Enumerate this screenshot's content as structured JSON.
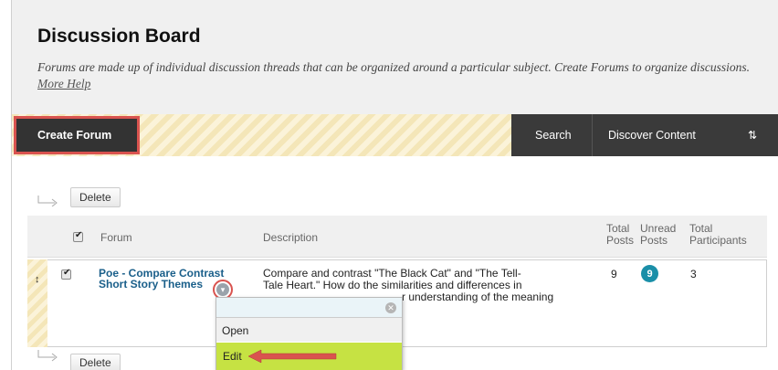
{
  "header": {
    "title": "Discussion Board",
    "subtitle": "Forums are made up of individual discussion threads that can be organized around a particular subject. Create Forums to organize discussions.",
    "help_link": "More Help"
  },
  "actionbar": {
    "create_forum": "Create Forum",
    "search": "Search",
    "discover": "Discover Content",
    "sort_icon": "⇅"
  },
  "list": {
    "delete_label": "Delete",
    "columns": {
      "forum": "Forum",
      "description": "Description",
      "total_posts_1": "Total",
      "total_posts_2": "Posts",
      "unread_posts_1": "Unread",
      "unread_posts_2": "Posts",
      "participants_1": "Total",
      "participants_2": "Participants"
    },
    "rows": [
      {
        "forum_line1": "Poe - Compare Contrast",
        "forum_line2": "Short Story Themes",
        "desc_line1": "Compare and contrast \"The Black Cat\" and \"The Tell-",
        "desc_line2": "Tale Heart.\" How do the similarities and differences in",
        "desc_line3": "r understanding of the meaning",
        "total_posts": "9",
        "unread_posts": "9",
        "participants": "3"
      }
    ]
  },
  "menu": {
    "open": "Open",
    "edit": "Edit"
  },
  "colors": {
    "highlight_red": "#d9534f",
    "edit_green": "#c6e243",
    "badge_teal": "#1a8fa8",
    "link_blue": "#1a5f8a"
  }
}
